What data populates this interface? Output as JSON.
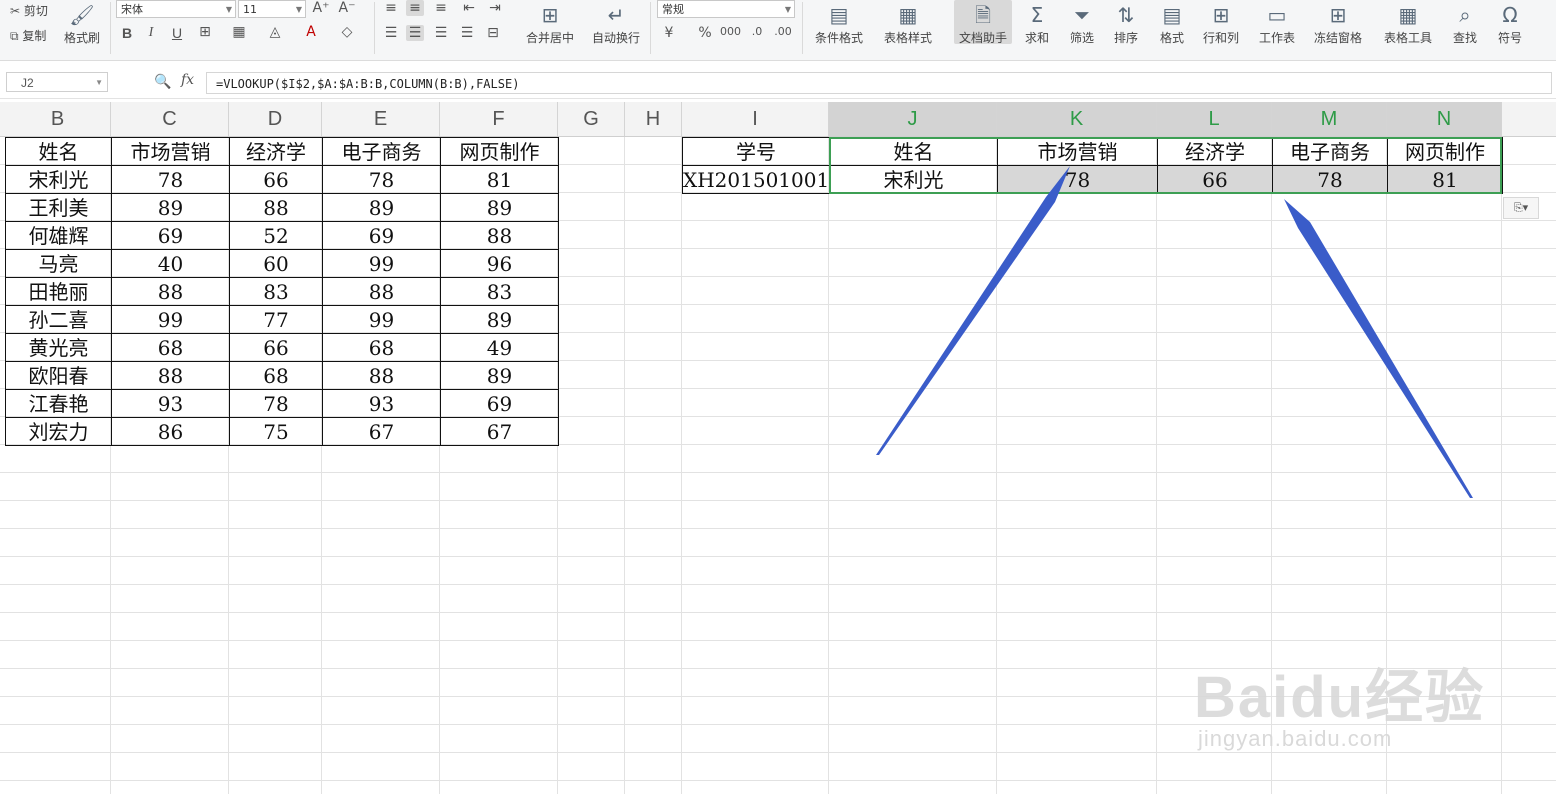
{
  "ribbon": {
    "cut_label": "剪切",
    "copy_label": "复制",
    "format_painter_label": "格式刷",
    "font_name": "宋体",
    "font_size": "11",
    "number_format": "常规",
    "merge_center_label": "合并居中",
    "wrap_text_label": "自动换行",
    "conditional_format_label": "条件格式",
    "table_style_label": "表格样式",
    "doc_assistant_label": "文档助手",
    "sum_label": "求和",
    "filter_label": "筛选",
    "sort_label": "排序",
    "format_label": "格式",
    "rows_cols_label": "行和列",
    "worksheet_label": "工作表",
    "freeze_label": "冻结窗格",
    "table_tools_label": "表格工具",
    "find_label": "查找",
    "symbol_label": "符号",
    "bold": "B",
    "italic": "I",
    "underline": "U",
    "percent": "%"
  },
  "formula_bar": {
    "name_box": "J2",
    "fx": "fx",
    "formula": "=VLOOKUP($I$2,$A:$A:B:B,COLUMN(B:B),FALSE)"
  },
  "columns": [
    "B",
    "C",
    "D",
    "E",
    "F",
    "G",
    "H",
    "I",
    "J",
    "K",
    "L",
    "M",
    "N"
  ],
  "left_table": {
    "headers": [
      "姓名",
      "市场营销",
      "经济学",
      "电子商务",
      "网页制作"
    ],
    "rows": [
      [
        "宋利光",
        "78",
        "66",
        "78",
        "81"
      ],
      [
        "王利美",
        "89",
        "88",
        "89",
        "89"
      ],
      [
        "何雄辉",
        "69",
        "52",
        "69",
        "88"
      ],
      [
        "马亮",
        "40",
        "60",
        "99",
        "96"
      ],
      [
        "田艳丽",
        "88",
        "83",
        "88",
        "83"
      ],
      [
        "孙二喜",
        "99",
        "77",
        "99",
        "89"
      ],
      [
        "黄光亮",
        "68",
        "66",
        "68",
        "49"
      ],
      [
        "欧阳春",
        "88",
        "68",
        "88",
        "89"
      ],
      [
        "江春艳",
        "93",
        "78",
        "93",
        "69"
      ],
      [
        "刘宏力",
        "86",
        "75",
        "67",
        "67"
      ]
    ]
  },
  "right_table": {
    "headers": [
      "学号",
      "姓名",
      "市场营销",
      "经济学",
      "电子商务",
      "网页制作"
    ],
    "row": [
      "XH201501001",
      "宋利光",
      "78",
      "66",
      "78",
      "81"
    ]
  },
  "watermark": {
    "logo": "Baidu经验",
    "url": "jingyan.baidu.com"
  },
  "colors": {
    "selection_green": "#3d9f54",
    "arrow_blue": "#3a5cc9",
    "selected_fill": "#d7d7d7"
  }
}
